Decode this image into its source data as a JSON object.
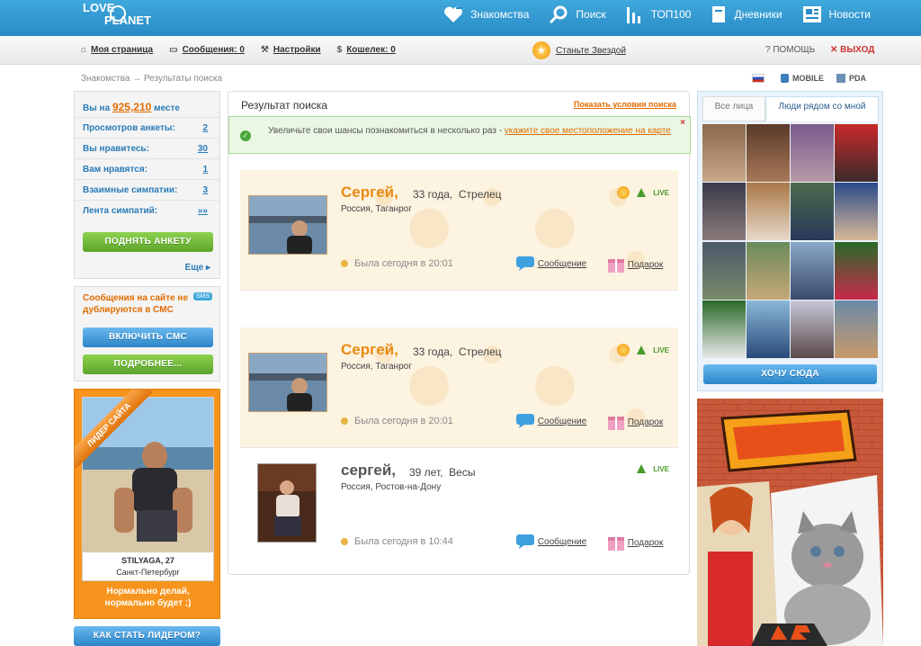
{
  "logo": {
    "line1": "LOVE",
    "line2": "PLANET"
  },
  "topnav": [
    {
      "label": "Знакомства",
      "icon": "heart-plus-icon"
    },
    {
      "label": "Поиск",
      "icon": "magnifier-icon"
    },
    {
      "label": "ТОП100",
      "icon": "bars-chart-icon"
    },
    {
      "label": "Дневники",
      "icon": "diary-icon"
    },
    {
      "label": "Новости",
      "icon": "newspaper-icon"
    }
  ],
  "subnav": [
    {
      "label": "Моя страница",
      "icon": "home-icon"
    },
    {
      "label": "Сообщения: 0",
      "icon": "speech-bubble-icon"
    },
    {
      "label": "Настройки",
      "icon": "wrench-icon"
    },
    {
      "label": "Кошелек: 0",
      "icon": "dollar-icon"
    }
  ],
  "star_link": "Станьте Звездой",
  "help": "? ПОМОЩЬ",
  "exit": "✕ ВЫХОД",
  "breadcrumb": "Знакомства → Результаты поиска",
  "mobile": {
    "mobile": "MOBILE",
    "pda": "PDA"
  },
  "stats": {
    "place_prefix": "Вы на",
    "place_value": "925,210",
    "place_suffix": "месте",
    "rows": [
      {
        "label": "Просмотров анкеты:",
        "value": "2"
      },
      {
        "label": "Вы нравитесь:",
        "value": "30"
      },
      {
        "label": "Вам нравятся:",
        "value": "1"
      },
      {
        "label": "Взаимные симпатии:",
        "value": "3"
      },
      {
        "label": "Лента симпатий:",
        "value": "»»"
      }
    ],
    "raise_button": "ПОДНЯТЬ АНКЕТУ",
    "more": "Еще ▸"
  },
  "sms": {
    "text": "Сообщения на сайте не дублируются в СМС",
    "badge": "SMS",
    "enable_button": "ВКЛЮЧИТЬ СМС",
    "details_button": "ПОДРОБНЕЕ..."
  },
  "leader": {
    "ribbon": "ЛИДЕР САЙТА",
    "name": "STILYAGA, 27",
    "city": "Санкт-Петербург",
    "footer": "Нормально делай, нормально будет ;)",
    "how_button": "КАК СТАТЬ ЛИДЕРОМ?"
  },
  "results": {
    "title": "Результат поиска",
    "show_conditions": "Показать условия поиска",
    "notice_prefix": "Увеличьте свои шансы познакомиться в несколько раз - ",
    "notice_link": "укажите свое местоположение на карте",
    "cards": [
      {
        "name": "Сергей,",
        "age": "33 года,",
        "sign": "Стрелец",
        "location": "Россия, Таганрог",
        "online": "Была сегодня в 20:01",
        "message": "Сообщение",
        "gift": "Подарок",
        "live": "LIVE",
        "vip": true
      },
      {
        "name": "Сергей,",
        "age": "33 года,",
        "sign": "Стрелец",
        "location": "Россия, Таганрог",
        "online": "Была сегодня в 20:01",
        "message": "Сообщение",
        "gift": "Подарок",
        "live": "LIVE",
        "vip": true
      },
      {
        "name": "сергей,",
        "age": "39 лет,",
        "sign": "Весы",
        "location": "Россия, Ростов-на-Дону",
        "online": "Была сегодня в 10:44",
        "message": "Сообщение",
        "gift": "Подарок",
        "live": "LIVE",
        "vip": false
      }
    ]
  },
  "nearby": {
    "tab_all": "Все лица",
    "tab_near": "Люди рядом со мной",
    "want_button": "ХОЧУ СЮДА"
  },
  "colors": {
    "accent": "#2a8bc6",
    "orange": "#e88a10",
    "green": "#5ca52b"
  }
}
